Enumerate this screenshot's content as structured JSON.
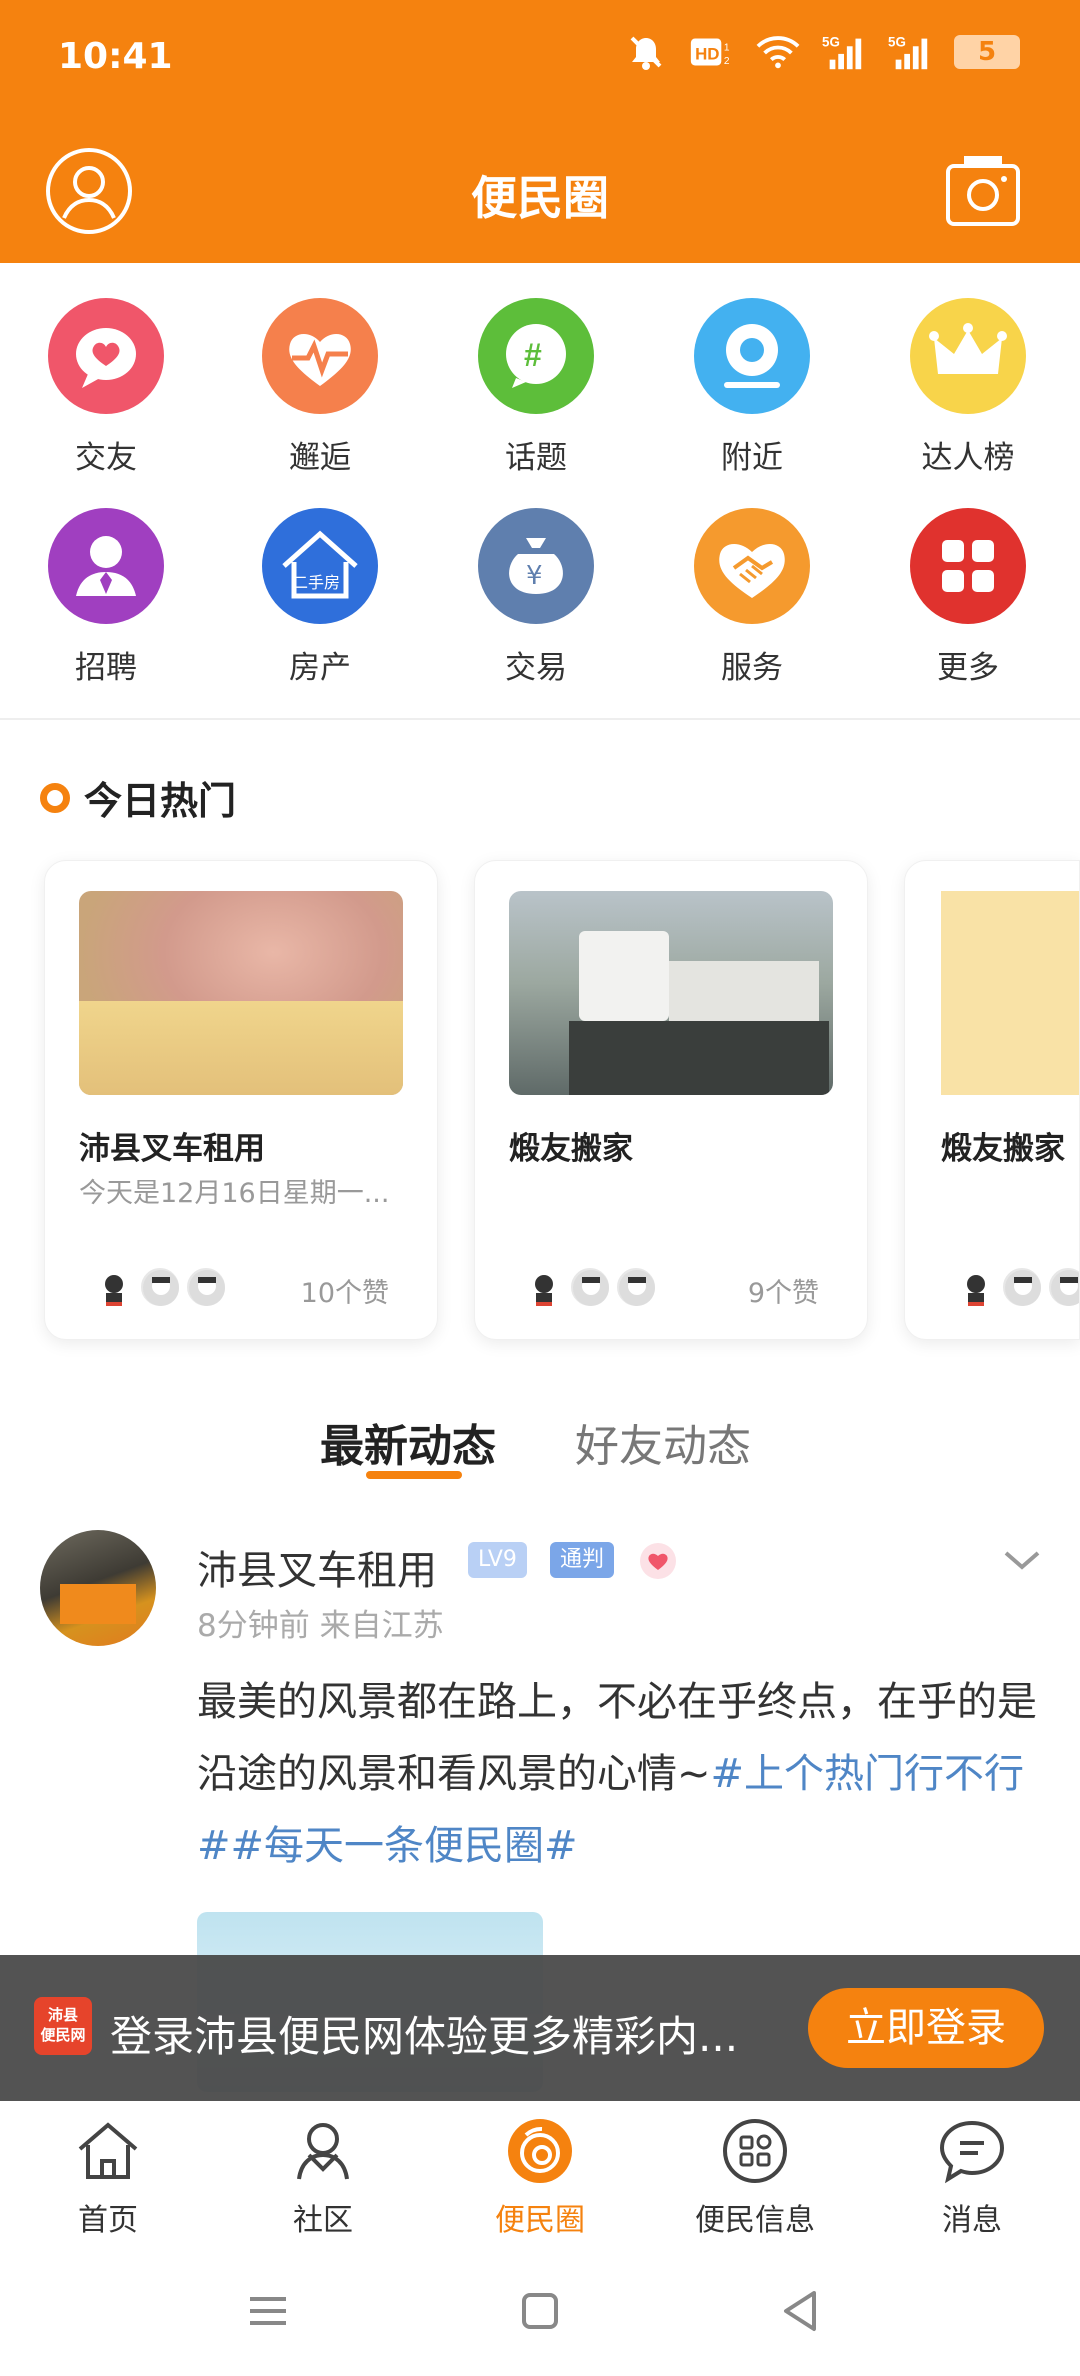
{
  "status": {
    "time": "10:41",
    "battery": "5"
  },
  "appbar": {
    "title": "便民圈"
  },
  "grid": [
    {
      "label": "交友",
      "icon": "heart-chat-icon",
      "color": "#F0566A"
    },
    {
      "label": "邂逅",
      "icon": "heartbeat-icon",
      "color": "#F5804C"
    },
    {
      "label": "话题",
      "icon": "hashtag-icon",
      "color": "#5DBE3A"
    },
    {
      "label": "附近",
      "icon": "location-icon",
      "color": "#43B1F0"
    },
    {
      "label": "达人榜",
      "icon": "crown-icon",
      "color": "#F8D44A"
    },
    {
      "label": "招聘",
      "icon": "recruit-icon",
      "color": "#A03FC0"
    },
    {
      "label": "房产",
      "icon": "house-icon",
      "color": "#2F6FDB",
      "icon_text": "二手房"
    },
    {
      "label": "交易",
      "icon": "money-bag-icon",
      "color": "#5F7FAE",
      "icon_text": "¥"
    },
    {
      "label": "服务",
      "icon": "handshake-icon",
      "color": "#F59A2E"
    },
    {
      "label": "更多",
      "icon": "more-grid-icon",
      "color": "#E0322E"
    }
  ],
  "hot": {
    "title": "今日热门",
    "cards": [
      {
        "title": "沛县叉车租用",
        "subtitle": "今天是12月16日星期一...",
        "likes": "10个赞"
      },
      {
        "title": "煅友搬家",
        "subtitle": "",
        "likes": "9个赞"
      },
      {
        "title": "煅友搬家",
        "subtitle": "",
        "likes": ""
      }
    ]
  },
  "tabs": {
    "latest": "最新动态",
    "friends": "好友动态"
  },
  "post": {
    "user": "沛县叉车租用",
    "level": "LV9",
    "role": "通判",
    "meta": "8分钟前  来自江苏",
    "text": "最美的风景都在路上，不必在乎终点，在乎的是沿途的风景和看风景的心情~",
    "tags": "#上个热门行不行##每天一条便民圈#"
  },
  "banner": {
    "logo_line1": "沛县",
    "logo_line2": "便民网",
    "text": "登录沛县便民网体验更多精彩内...",
    "button": "立即登录"
  },
  "nav": [
    {
      "label": "首页",
      "icon": "home-icon"
    },
    {
      "label": "社区",
      "icon": "community-icon"
    },
    {
      "label": "便民圈",
      "icon": "circle-icon"
    },
    {
      "label": "便民信息",
      "icon": "info-grid-icon"
    },
    {
      "label": "消息",
      "icon": "message-icon"
    }
  ],
  "colors": {
    "brand": "#F5820F",
    "tag": "#4F86C6"
  }
}
